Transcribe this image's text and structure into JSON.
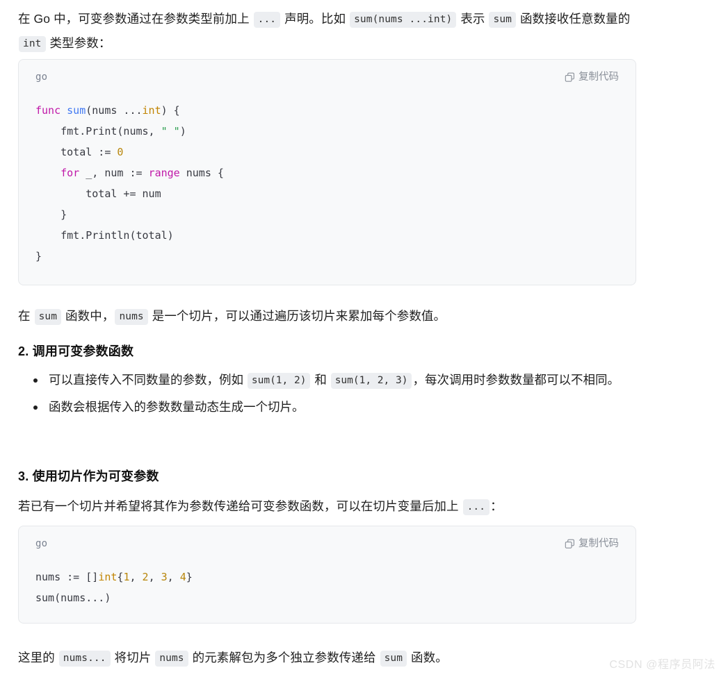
{
  "document": {
    "intro_paragraph": {
      "parts": [
        {
          "type": "text",
          "value": "在 Go 中，可变参数通过在参数类型前加上 "
        },
        {
          "type": "code",
          "value": "..."
        },
        {
          "type": "text",
          "value": " 声明。比如 "
        },
        {
          "type": "code",
          "value": "sum(nums ...int)"
        },
        {
          "type": "text",
          "value": " 表示 "
        },
        {
          "type": "code",
          "value": "sum"
        },
        {
          "type": "text",
          "value": " 函数接收任意数量的 "
        },
        {
          "type": "code",
          "value": "int"
        },
        {
          "type": "text",
          "value": " 类型参数："
        }
      ],
      "plain": "在 Go 中，可变参数通过在参数类型前加上 ... 声明。比如 sum(nums ...int) 表示 sum 函数接收任意数量的 int 类型参数："
    },
    "code_block_1": {
      "language": "go",
      "copy_label": "复制代码",
      "copy_icon": "copy-icon",
      "code_plain": "func sum(nums ...int) {\n    fmt.Print(nums, \" \")\n    total := 0\n    for _, num := range nums {\n        total += num\n    }\n    fmt.Println(total)\n}",
      "lines": [
        [
          {
            "t": "kw",
            "v": "func"
          },
          {
            "t": "pl",
            "v": " "
          },
          {
            "t": "fn",
            "v": "sum"
          },
          {
            "t": "pl",
            "v": "(nums ..."
          },
          {
            "t": "type",
            "v": "int"
          },
          {
            "t": "pl",
            "v": ") {"
          }
        ],
        [
          {
            "t": "pl",
            "v": "    fmt.Print(nums, "
          },
          {
            "t": "str",
            "v": "\" \""
          },
          {
            "t": "pl",
            "v": ")"
          }
        ],
        [
          {
            "t": "pl",
            "v": "    total := "
          },
          {
            "t": "num",
            "v": "0"
          }
        ],
        [
          {
            "t": "pl",
            "v": "    "
          },
          {
            "t": "kw",
            "v": "for"
          },
          {
            "t": "pl",
            "v": " _, num := "
          },
          {
            "t": "kw",
            "v": "range"
          },
          {
            "t": "pl",
            "v": " nums {"
          }
        ],
        [
          {
            "t": "pl",
            "v": "        total += num"
          }
        ],
        [
          {
            "t": "pl",
            "v": "    }"
          }
        ],
        [
          {
            "t": "pl",
            "v": "    fmt.Println(total)"
          }
        ],
        [
          {
            "t": "pl",
            "v": "}"
          }
        ]
      ]
    },
    "paragraph_after_code1": {
      "parts": [
        {
          "type": "text",
          "value": "在 "
        },
        {
          "type": "code",
          "value": "sum"
        },
        {
          "type": "text",
          "value": " 函数中，"
        },
        {
          "type": "code",
          "value": "nums"
        },
        {
          "type": "text",
          "value": " 是一个切片，可以通过遍历该切片来累加每个参数值。"
        }
      ],
      "plain": "在 sum 函数中，nums 是一个切片，可以通过遍历该切片来累加每个参数值。"
    },
    "section_2": {
      "heading": "2. 调用可变参数函数",
      "bullets": [
        {
          "parts": [
            {
              "type": "text",
              "value": "可以直接传入不同数量的参数，例如 "
            },
            {
              "type": "code",
              "value": "sum(1, 2)"
            },
            {
              "type": "text",
              "value": " 和 "
            },
            {
              "type": "code",
              "value": "sum(1, 2, 3)"
            },
            {
              "type": "text",
              "value": "，每次调用时参数数量都可以不相同。"
            }
          ],
          "plain": "可以直接传入不同数量的参数，例如 sum(1, 2) 和 sum(1, 2, 3)，每次调用时参数数量都可以不相同。"
        },
        {
          "parts": [
            {
              "type": "text",
              "value": "函数会根据传入的参数数量动态生成一个切片。"
            }
          ],
          "plain": "函数会根据传入的参数数量动态生成一个切片。"
        }
      ]
    },
    "section_3": {
      "heading": "3. 使用切片作为可变参数",
      "paragraph": {
        "parts": [
          {
            "type": "text",
            "value": "若已有一个切片并希望将其作为参数传递给可变参数函数，可以在切片变量后加上 "
          },
          {
            "type": "code",
            "value": "..."
          },
          {
            "type": "text",
            "value": "："
          }
        ],
        "plain": "若已有一个切片并希望将其作为参数传递给可变参数函数，可以在切片变量后加上 ...："
      }
    },
    "code_block_2": {
      "language": "go",
      "copy_label": "复制代码",
      "copy_icon": "copy-icon",
      "code_plain": "nums := []int{1, 2, 3, 4}\nsum(nums...)",
      "lines": [
        [
          {
            "t": "pl",
            "v": "nums := []"
          },
          {
            "t": "type",
            "v": "int"
          },
          {
            "t": "pl",
            "v": "{"
          },
          {
            "t": "num",
            "v": "1"
          },
          {
            "t": "pl",
            "v": ", "
          },
          {
            "t": "num",
            "v": "2"
          },
          {
            "t": "pl",
            "v": ", "
          },
          {
            "t": "num",
            "v": "3"
          },
          {
            "t": "pl",
            "v": ", "
          },
          {
            "t": "num",
            "v": "4"
          },
          {
            "t": "pl",
            "v": "}"
          }
        ],
        [
          {
            "t": "pl",
            "v": "sum(nums...)"
          }
        ]
      ]
    },
    "closing_paragraph": {
      "parts": [
        {
          "type": "text",
          "value": "这里的 "
        },
        {
          "type": "code",
          "value": "nums..."
        },
        {
          "type": "text",
          "value": " 将切片 "
        },
        {
          "type": "code",
          "value": "nums"
        },
        {
          "type": "text",
          "value": " 的元素解包为多个独立参数传递给 "
        },
        {
          "type": "code",
          "value": "sum"
        },
        {
          "type": "text",
          "value": " 函数。"
        }
      ],
      "plain": "这里的 nums... 将切片 nums 的元素解包为多个独立参数传递给 sum 函数。"
    },
    "watermark": "CSDN @程序员阿法"
  },
  "colors": {
    "keyword": "#c018a8",
    "function": "#4078f2",
    "type": "#c18401",
    "number": "#b8860b",
    "string": "#2a9d4e",
    "code_bg": "#f8f9fa",
    "inline_code_bg": "#eceef1",
    "text": "#1f1f1f",
    "muted": "#8a9099",
    "watermark": "#e2e2e2"
  }
}
